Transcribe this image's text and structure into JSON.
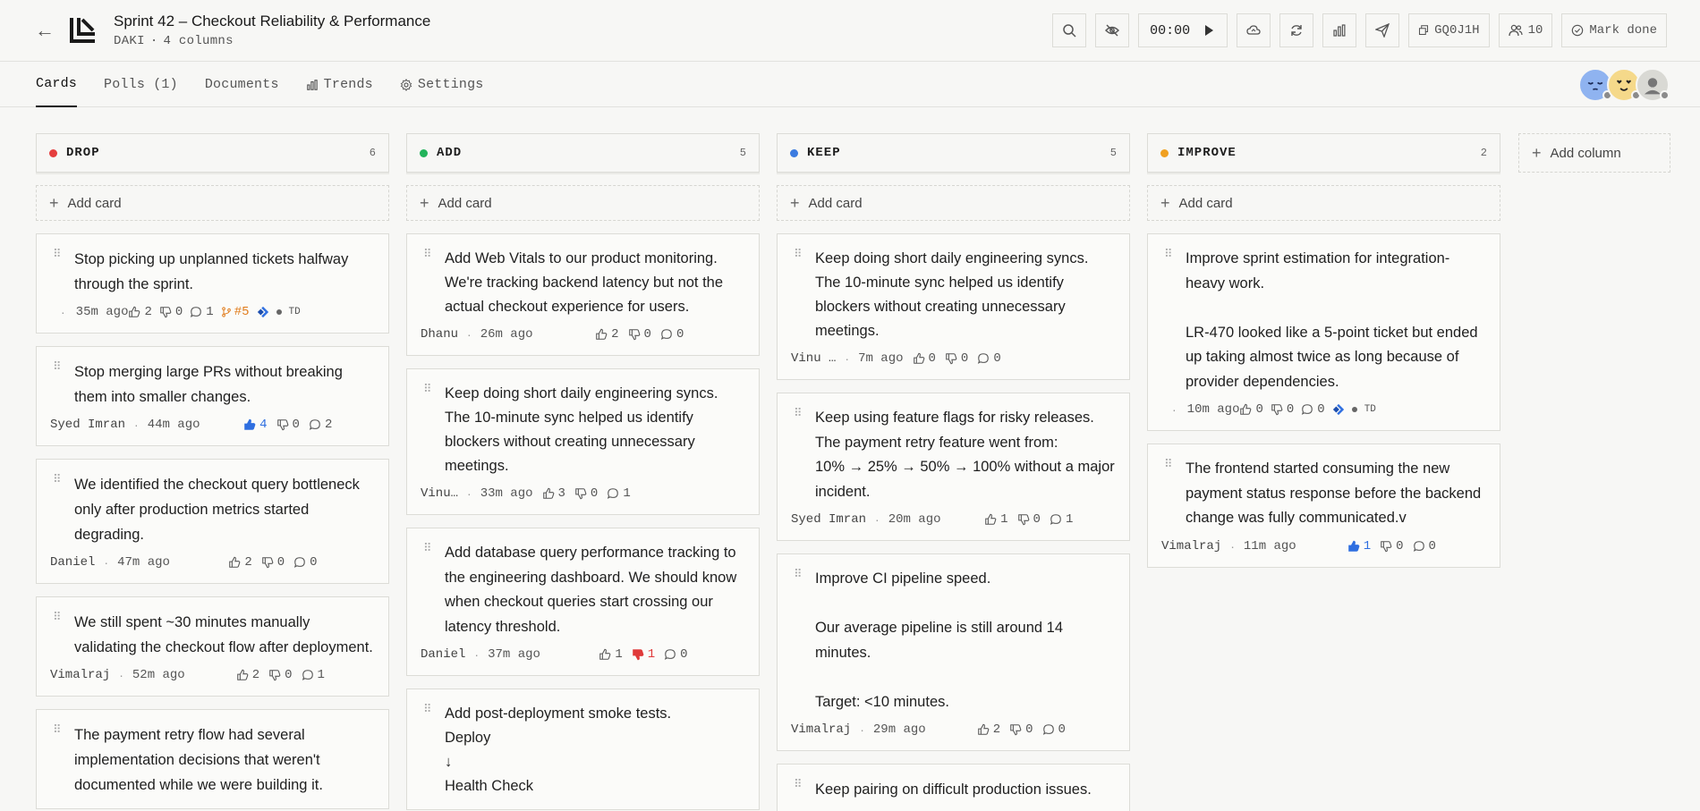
{
  "header": {
    "title": "Sprint 42 – Checkout Reliability & Performance",
    "workspace": "DAKI",
    "separator": "·",
    "column_count": "4 columns",
    "timer": "00:00",
    "room_code": "GQ0J1H",
    "participants": "10",
    "mark_done": "Mark done"
  },
  "tabs": [
    {
      "label": "Cards",
      "active": true
    },
    {
      "label": "Polls (1)",
      "active": false
    },
    {
      "label": "Documents",
      "active": false
    },
    {
      "label": "Trends",
      "active": false
    },
    {
      "label": "Settings",
      "active": false
    }
  ],
  "board": {
    "add_card": "Add card",
    "add_column": "Add column",
    "columns": [
      {
        "name": "DROP",
        "count": "6",
        "color": "#e53e3e",
        "cards": [
          {
            "text": "Stop picking up unplanned tickets halfway through the sprint.",
            "author": "",
            "time": "35m ago",
            "up": "2",
            "down": "0",
            "comments": "1",
            "pr": "#5",
            "jira": true,
            "td": "TD"
          },
          {
            "text": "Stop merging large PRs without breaking them into smaller changes.",
            "author": "Syed Imran",
            "time": "44m ago",
            "up": "4",
            "up_active": true,
            "down": "0",
            "comments": "2"
          },
          {
            "text": "We identified the checkout query bottleneck only after production metrics started degrading.",
            "author": "Daniel",
            "time": "47m ago",
            "up": "2",
            "down": "0",
            "comments": "0"
          },
          {
            "text": "We still spent ~30 minutes manually validating the checkout flow after deployment.",
            "author": "Vimalraj",
            "time": "52m ago",
            "up": "2",
            "down": "0",
            "comments": "1"
          },
          {
            "text": "The payment retry flow had several implementation decisions that weren't documented while we were building it.",
            "author": "",
            "time": "",
            "up": "",
            "down": "",
            "comments": ""
          }
        ]
      },
      {
        "name": "ADD",
        "count": "5",
        "color": "#22b35a",
        "cards": [
          {
            "text": "Add Web Vitals to our product monitoring. We're tracking backend latency but not the actual checkout experience for users.",
            "author": "Dhanu",
            "time": "26m ago",
            "up": "2",
            "down": "0",
            "comments": "0"
          },
          {
            "text": "Keep doing short daily engineering syncs. The 10-minute sync helped us identify blockers without creating unnecessary meetings.",
            "author": "Vinu…",
            "time": "33m ago",
            "up": "3",
            "down": "0",
            "comments": "1"
          },
          {
            "text": "Add database query performance tracking to the engineering dashboard.  We should know when checkout queries start crossing our latency threshold.",
            "author": "Daniel",
            "time": "37m ago",
            "up": "1",
            "down": "1",
            "down_active": true,
            "comments": "0"
          },
          {
            "text": "Add post-deployment smoke tests.\nDeploy\n↓\nHealth Check",
            "author": "",
            "time": "",
            "up": "",
            "down": "",
            "comments": ""
          }
        ]
      },
      {
        "name": "KEEP",
        "count": "5",
        "color": "#3b7be0",
        "cards": [
          {
            "text": "Keep doing short daily engineering syncs. The 10-minute sync helped us identify blockers without creating unnecessary meetings.",
            "author": "Vinu …",
            "time": "7m ago",
            "up": "0",
            "down": "0",
            "comments": "0"
          },
          {
            "text": "Keep using feature flags for risky releases. The payment retry feature went from:\n10% → 25% → 50% → 100% without a major incident.",
            "author": "Syed Imran",
            "time": "20m ago",
            "up": "1",
            "down": "0",
            "comments": "1"
          },
          {
            "text": "Improve CI pipeline speed.\n\nOur average pipeline is still around 14 minutes.\n\nTarget: <10 minutes.",
            "author": "Vimalraj",
            "time": "29m ago",
            "up": "2",
            "down": "0",
            "comments": "0"
          },
          {
            "text": "Keep pairing on difficult production issues.",
            "author": "",
            "time": "",
            "up": "",
            "down": "",
            "comments": ""
          }
        ]
      },
      {
        "name": "IMPROVE",
        "count": "2",
        "color": "#f0a020",
        "cards": [
          {
            "text": "Improve sprint estimation for integration-heavy work.\n\nLR-470 looked like a 5-point ticket but ended up taking almost twice as long because of provider dependencies.",
            "author": "",
            "time": "10m ago",
            "up": "0",
            "down": "0",
            "comments": "0",
            "jira": true,
            "td": "TD"
          },
          {
            "text": "The frontend started consuming the new payment status response before the backend change was fully communicated.v",
            "author": "Vimalraj",
            "time": "11m ago",
            "up": "1",
            "up_active": true,
            "down": "0",
            "comments": "0"
          }
        ]
      }
    ]
  }
}
